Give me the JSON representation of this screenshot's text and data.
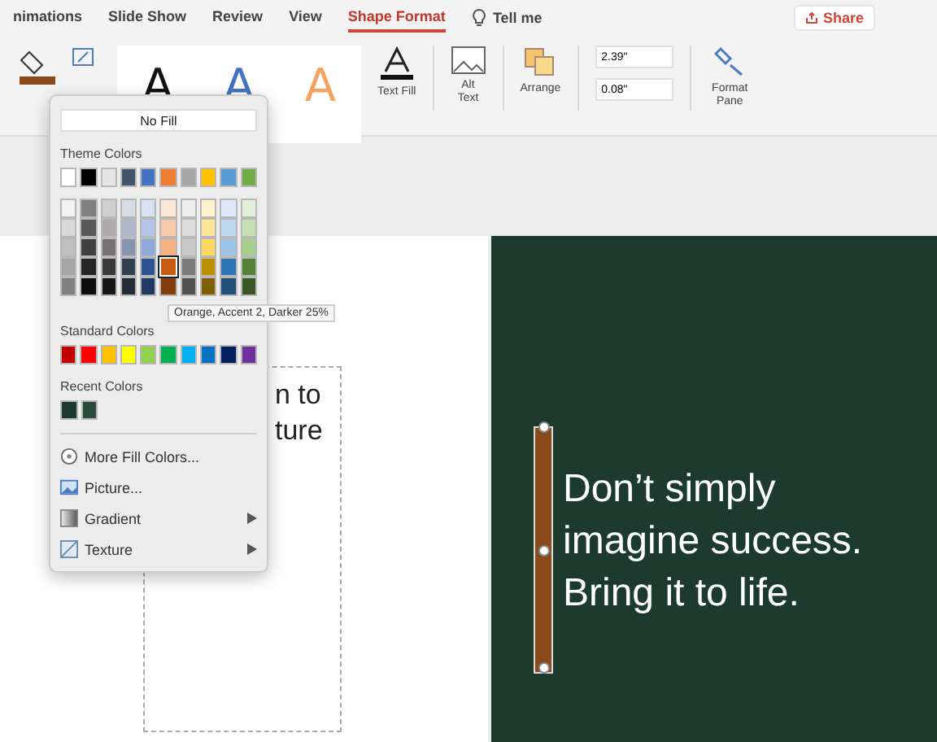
{
  "ribbon_tabs": [
    {
      "label": "nimations",
      "selected": false
    },
    {
      "label": "Slide Show",
      "selected": false
    },
    {
      "label": "Review",
      "selected": false
    },
    {
      "label": "View",
      "selected": false
    },
    {
      "label": "Shape Format",
      "selected": true
    }
  ],
  "tell_me": "Tell me",
  "share_button": "Share",
  "wordart_styles": [
    {
      "label": "A",
      "color": "#111111"
    },
    {
      "label": "A",
      "color": "#4472c4"
    },
    {
      "label": "A",
      "color": "#f4a460"
    }
  ],
  "ribbon": {
    "text_fill_label": "Text Fill",
    "alt_text_label": "Alt Text",
    "arrange_label": "Arrange",
    "height_value": "2.39\"",
    "width_value": "0.08\"",
    "format_pane_label": "Format Pane"
  },
  "fill_menu": {
    "no_fill": "No Fill",
    "theme_colors_label": "Theme Colors",
    "theme_top": [
      {
        "color": "#ffffff",
        "selected": false
      },
      {
        "color": "#000000",
        "selected": false
      },
      {
        "color": "#e7e6e6",
        "selected": false
      },
      {
        "color": "#44546a",
        "selected": false
      },
      {
        "color": "#4472c4",
        "selected": false
      },
      {
        "color": "#ed7d31",
        "selected": false
      },
      {
        "color": "#a5a5a5",
        "selected": false
      },
      {
        "color": "#ffc000",
        "selected": false
      },
      {
        "color": "#5b9bd5",
        "selected": false
      },
      {
        "color": "#70ad47",
        "selected": false
      }
    ],
    "theme_shades": [
      [
        {
          "color": "#f2f2f2",
          "selected": false
        },
        {
          "color": "#808080",
          "selected": false
        },
        {
          "color": "#d0cece",
          "selected": false
        },
        {
          "color": "#d6dce4",
          "selected": false
        },
        {
          "color": "#d9e2f3",
          "selected": false
        },
        {
          "color": "#fbe5d5",
          "selected": false
        },
        {
          "color": "#ededed",
          "selected": false
        },
        {
          "color": "#fff2cc",
          "selected": false
        },
        {
          "color": "#deebf6",
          "selected": false
        },
        {
          "color": "#e2efd9",
          "selected": false
        }
      ],
      [
        {
          "color": "#d9d9d9",
          "selected": false
        },
        {
          "color": "#595959",
          "selected": false
        },
        {
          "color": "#aeaaaa",
          "selected": false
        },
        {
          "color": "#adb9ca",
          "selected": false
        },
        {
          "color": "#b4c6e7",
          "selected": false
        },
        {
          "color": "#f7caac",
          "selected": false
        },
        {
          "color": "#dbdbdb",
          "selected": false
        },
        {
          "color": "#ffe699",
          "selected": false
        },
        {
          "color": "#bdd7ee",
          "selected": false
        },
        {
          "color": "#c5e0b3",
          "selected": false
        }
      ],
      [
        {
          "color": "#bfbfbf",
          "selected": false
        },
        {
          "color": "#404040",
          "selected": false
        },
        {
          "color": "#757171",
          "selected": false
        },
        {
          "color": "#8496b0",
          "selected": false
        },
        {
          "color": "#8eaadb",
          "selected": false
        },
        {
          "color": "#f4b183",
          "selected": false
        },
        {
          "color": "#c9c9c9",
          "selected": false
        },
        {
          "color": "#ffd966",
          "selected": false
        },
        {
          "color": "#9dc3e6",
          "selected": false
        },
        {
          "color": "#a8d08d",
          "selected": false
        }
      ],
      [
        {
          "color": "#a6a6a6",
          "selected": false
        },
        {
          "color": "#262626",
          "selected": false
        },
        {
          "color": "#3a3838",
          "selected": false
        },
        {
          "color": "#323f4f",
          "selected": false
        },
        {
          "color": "#2f5496",
          "selected": false
        },
        {
          "color": "#c55a11",
          "selected": true
        },
        {
          "color": "#7b7b7b",
          "selected": false
        },
        {
          "color": "#bf9000",
          "selected": false
        },
        {
          "color": "#2e75b5",
          "selected": false
        },
        {
          "color": "#538135",
          "selected": false
        }
      ],
      [
        {
          "color": "#808080",
          "selected": false
        },
        {
          "color": "#0d0d0d",
          "selected": false
        },
        {
          "color": "#171616",
          "selected": false
        },
        {
          "color": "#222a35",
          "selected": false
        },
        {
          "color": "#1f3864",
          "selected": false
        },
        {
          "color": "#833c0b",
          "selected": false
        },
        {
          "color": "#525252",
          "selected": false
        },
        {
          "color": "#7f6000",
          "selected": false
        },
        {
          "color": "#1f4e79",
          "selected": false
        },
        {
          "color": "#375623",
          "selected": false
        }
      ]
    ],
    "standard_colors_label": "Standard Colors",
    "standard_colors": [
      {
        "color": "#c00000",
        "selected": false
      },
      {
        "color": "#ff0000",
        "selected": false
      },
      {
        "color": "#ffc000",
        "selected": false
      },
      {
        "color": "#ffff00",
        "selected": false
      },
      {
        "color": "#92d050",
        "selected": false
      },
      {
        "color": "#00b050",
        "selected": false
      },
      {
        "color": "#00b0f0",
        "selected": false
      },
      {
        "color": "#0070c0",
        "selected": false
      },
      {
        "color": "#002060",
        "selected": false
      },
      {
        "color": "#7030a0",
        "selected": false
      }
    ],
    "recent_colors_label": "Recent Colors",
    "recent_colors": [
      {
        "color": "#1e3a2f",
        "selected": false
      },
      {
        "color": "#2a4a3c",
        "selected": false
      }
    ],
    "items": [
      {
        "kind": "wheel",
        "label": "More Fill Colors...",
        "submenu": false
      },
      {
        "kind": "picture",
        "label": "Picture...",
        "submenu": false
      },
      {
        "kind": "gradient",
        "label": "Gradient",
        "submenu": true
      },
      {
        "kind": "texture",
        "label": "Texture",
        "submenu": true
      }
    ]
  },
  "tooltip": "Orange, Accent 2, Darker 25%",
  "left_slide": {
    "lines": [
      "n to",
      "ture"
    ]
  },
  "right_slide": {
    "lines": [
      "Don’t simply",
      "imagine success.",
      "Bring it to life."
    ]
  }
}
